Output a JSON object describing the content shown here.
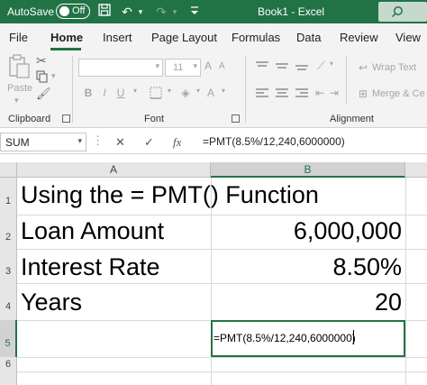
{
  "titlebar": {
    "autosave_label": "AutoSave",
    "toggle_state": "Off",
    "document_title": "Book1 - Excel",
    "accent": "#217346"
  },
  "tabs": [
    {
      "label": "File"
    },
    {
      "label": "Home",
      "active": true
    },
    {
      "label": "Insert"
    },
    {
      "label": "Page Layout"
    },
    {
      "label": "Formulas"
    },
    {
      "label": "Data"
    },
    {
      "label": "Review"
    },
    {
      "label": "View"
    }
  ],
  "ribbon": {
    "clipboard_label": "Clipboard",
    "paste_label": "Paste",
    "font_label": "Font",
    "font_size": "11",
    "alignment_label": "Alignment",
    "wrap_text_label": "Wrap Text",
    "merge_label": "Merge & Ce"
  },
  "formula_bar": {
    "name_box": "SUM",
    "formula": "=PMT(8.5%/12,240,6000000)"
  },
  "grid": {
    "columns": [
      "A",
      "B"
    ],
    "rows": [
      "1",
      "2",
      "3",
      "4",
      "5",
      "6"
    ],
    "cells": {
      "a1": "Using the = PMT() Function",
      "a2": "Loan Amount",
      "b2": "6,000,000",
      "a3": "Interest Rate",
      "b3": "8.50%",
      "a4": "Years",
      "b4": "20",
      "b5": "=PMT(8.5%/12,240,6000000)"
    }
  }
}
